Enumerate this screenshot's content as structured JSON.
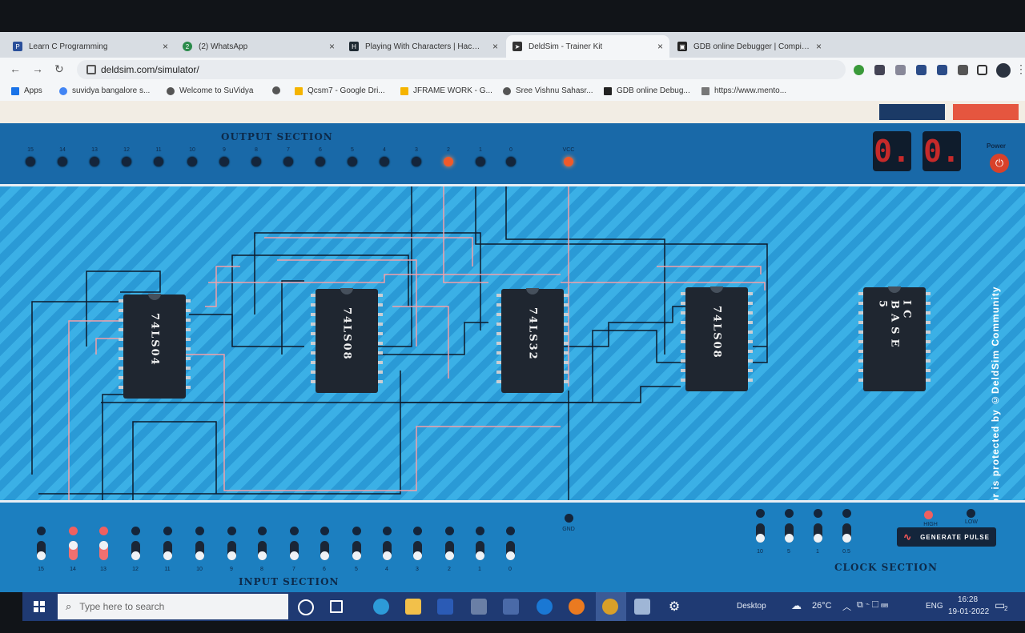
{
  "tabs": [
    {
      "label": "Learn C Programming",
      "active": false
    },
    {
      "label": "(2) WhatsApp",
      "active": false
    },
    {
      "label": "Playing With Characters | HackerRank",
      "active": false
    },
    {
      "label": "DeldSim - Trainer Kit",
      "active": true
    },
    {
      "label": "GDB online Debugger | Compiler",
      "active": false
    }
  ],
  "address": {
    "url": "deldsim.com/simulator/"
  },
  "bookmarks": [
    "Apps",
    "suvidya bangalore s...",
    "Welcome to SuVidya",
    "Qcsm7 - Google Dri...",
    "JFRAME WORK - G...",
    "Sree Vishnu Sahasr...",
    "GDB online Debug...",
    "https://www.mento..."
  ],
  "output_section": {
    "title": "OUTPUT SECTION",
    "pins": [
      {
        "label": "15",
        "on": false
      },
      {
        "label": "14",
        "on": false
      },
      {
        "label": "13",
        "on": false
      },
      {
        "label": "12",
        "on": false
      },
      {
        "label": "11",
        "on": false
      },
      {
        "label": "10",
        "on": false
      },
      {
        "label": "9",
        "on": false
      },
      {
        "label": "8",
        "on": false
      },
      {
        "label": "7",
        "on": false
      },
      {
        "label": "6",
        "on": false
      },
      {
        "label": "5",
        "on": false
      },
      {
        "label": "4",
        "on": false
      },
      {
        "label": "3",
        "on": false
      },
      {
        "label": "2",
        "on": true
      },
      {
        "label": "1",
        "on": false
      },
      {
        "label": "0",
        "on": false
      }
    ],
    "vcc_label": "VCC",
    "digits": [
      "0.",
      "0."
    ],
    "power_label": "Power"
  },
  "ics": [
    {
      "name": "74LS04"
    },
    {
      "name": "74LS08"
    },
    {
      "name": "74LS32"
    },
    {
      "name": "74LS08"
    },
    {
      "name": "IC BASE 5"
    }
  ],
  "watermark": "This simulator is protected by ©DeldSim Community",
  "input_section": {
    "title": "INPUT SECTION",
    "switches": [
      {
        "label": "15",
        "on": false
      },
      {
        "label": "14",
        "on": true
      },
      {
        "label": "13",
        "on": true
      },
      {
        "label": "12",
        "on": false
      },
      {
        "label": "11",
        "on": false
      },
      {
        "label": "10",
        "on": false
      },
      {
        "label": "9",
        "on": false
      },
      {
        "label": "8",
        "on": false
      },
      {
        "label": "7",
        "on": false
      },
      {
        "label": "6",
        "on": false
      },
      {
        "label": "5",
        "on": false
      },
      {
        "label": "4",
        "on": false
      },
      {
        "label": "3",
        "on": false
      },
      {
        "label": "2",
        "on": false
      },
      {
        "label": "1",
        "on": false
      },
      {
        "label": "0",
        "on": false
      }
    ],
    "gnd_label": "GND"
  },
  "clock_section": {
    "title": "CLOCK SECTION",
    "rates": [
      "10",
      "5",
      "1",
      "0.5"
    ],
    "high_label": "HIGH",
    "low_label": "LOW",
    "generate_label": "GENERATE PULSE"
  },
  "taskbar": {
    "search_placeholder": "Type here to search",
    "desktop_label": "Desktop",
    "weather": "26°C",
    "lang": "ENG",
    "time": "16:28",
    "date": "19-01-2022",
    "notif_count": "2"
  }
}
